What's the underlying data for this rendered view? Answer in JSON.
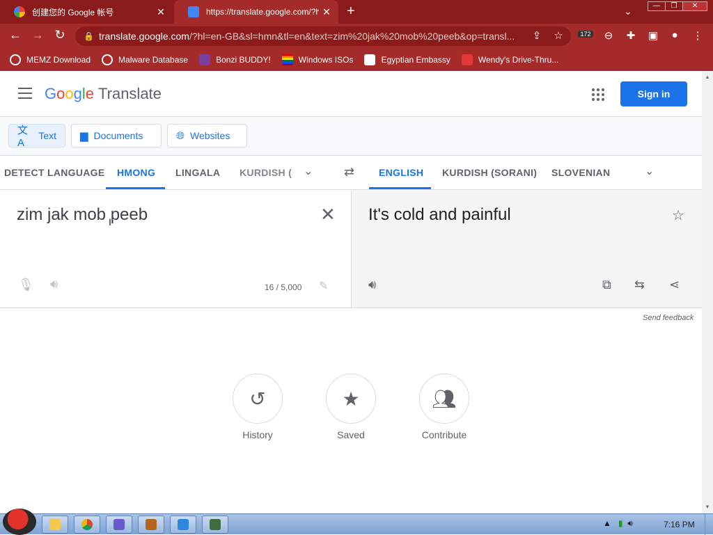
{
  "browser": {
    "tabs": [
      {
        "title": "创建您的 Google 帐号",
        "close": "✕"
      },
      {
        "title": "https://translate.google.com/?hl=",
        "close": "✕"
      }
    ],
    "new_tab": "+",
    "tab_menu": "⌄",
    "window_controls": [
      "—",
      "❐",
      "✕"
    ],
    "url_host": "translate.google.com",
    "url_path": "/?hl=en-GB&sl=hmn&tl=en&text=zim%20jak%20mob%20peeb&op=transl...",
    "extension_badge": "172",
    "bookmarks": [
      {
        "label": "MEMZ Download",
        "color": "#ffffff"
      },
      {
        "label": "Malware Database",
        "color": "#ffffff"
      },
      {
        "label": "Bonzi BUDDY!",
        "color": "#8e44ad"
      },
      {
        "label": "Windows ISOs",
        "color": "#f1c40f"
      },
      {
        "label": "Egyptian Embassy",
        "color": "#ffffff"
      },
      {
        "label": "Wendy's Drive-Thru...",
        "color": "#e53935"
      }
    ]
  },
  "header": {
    "logo_letters": [
      "G",
      "o",
      "o",
      "g",
      "l",
      "e"
    ],
    "product": "Translate",
    "sign_in": "Sign in"
  },
  "modes": [
    {
      "label": "Text",
      "icon": "translate-icon"
    },
    {
      "label": "Documents",
      "icon": "document-icon"
    },
    {
      "label": "Websites",
      "icon": "globe-icon"
    }
  ],
  "source_langs": [
    "DETECT LANGUAGE",
    "HMONG",
    "LINGALA",
    "KURDISH (S"
  ],
  "target_langs": [
    "ENGLISH",
    "KURDISH (SORANI)",
    "SLOVENIAN"
  ],
  "source": {
    "text": "zim jak mob peeb",
    "char_count": "16 / 5,000"
  },
  "target": {
    "text": "It's cold and painful"
  },
  "send_feedback": "Send feedback",
  "shortcuts": [
    {
      "label": "History",
      "icon": "history-icon"
    },
    {
      "label": "Saved",
      "icon": "star-icon"
    },
    {
      "label": "Contribute",
      "icon": "people-icon"
    }
  ],
  "taskbar": {
    "clock": "7:16 PM",
    "apps": [
      {
        "name": "explorer-icon",
        "color": "#f2c94c"
      },
      {
        "name": "chrome-icon",
        "color": "#db4437"
      },
      {
        "name": "winrar-icon",
        "color": "#6a5acd"
      },
      {
        "name": "toolbox-icon",
        "color": "#b5651d"
      },
      {
        "name": "game-icon",
        "color": "#2e86de"
      },
      {
        "name": "terminal-icon",
        "color": "#3c6e3c"
      }
    ]
  }
}
